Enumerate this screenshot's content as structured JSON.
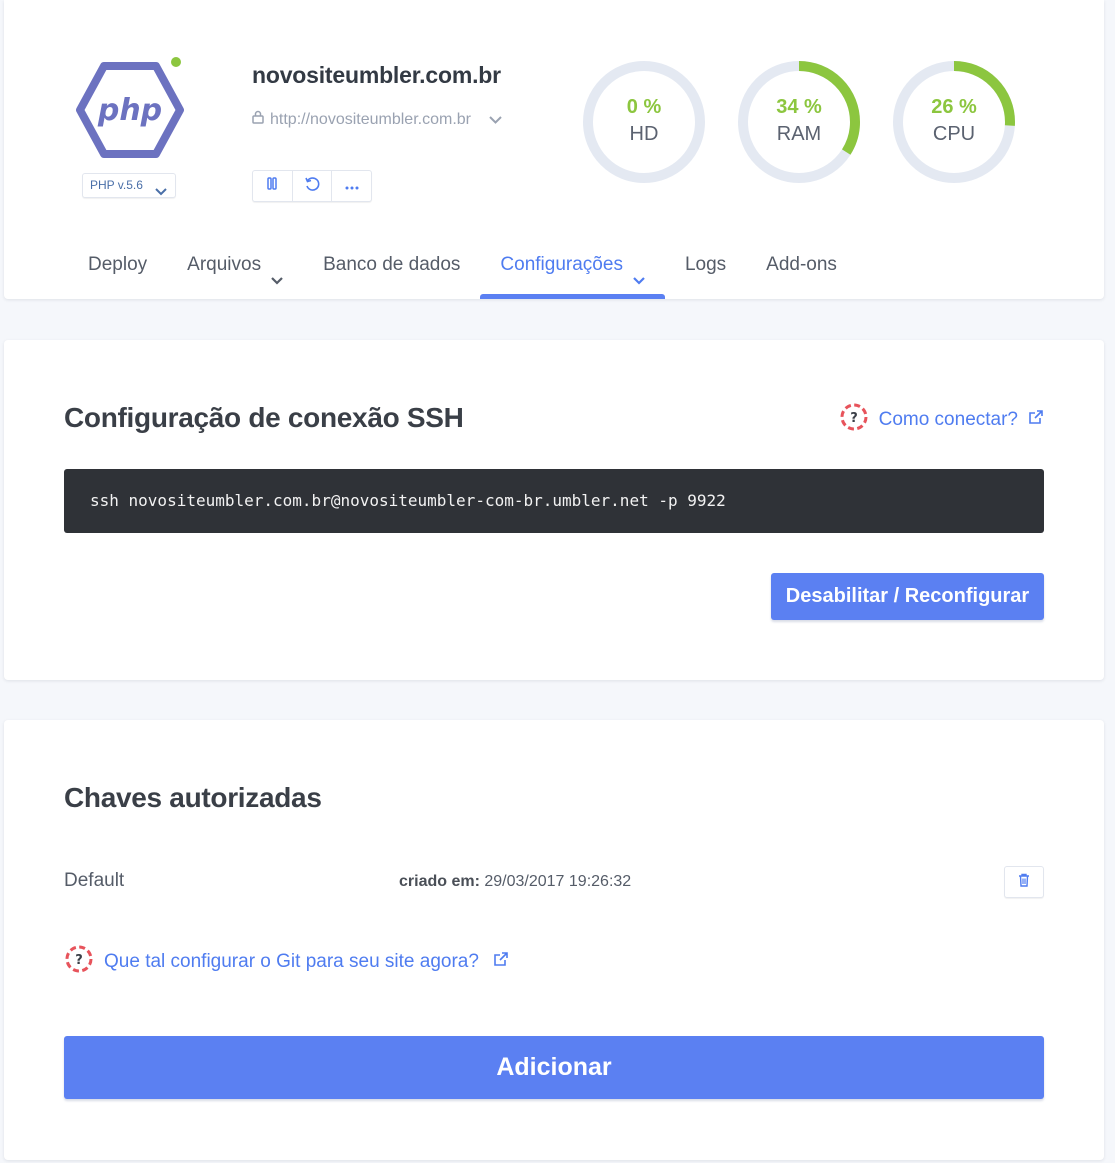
{
  "colors": {
    "accent": "#5b80f2",
    "link": "#4f7cf0",
    "gauge_fill": "#8cc63f",
    "gauge_track": "#e4e9f2",
    "php_logo": "#6c72c0",
    "online": "#8cc63f",
    "code_bg": "#2f3237"
  },
  "header": {
    "site_name": "novositeumbler.com.br",
    "site_url": "http://novositeumbler.com.br",
    "php_version": "PHP v.5.6",
    "logo_text": "php",
    "icons": {
      "logo": "php-logo-icon",
      "lock": "lock-icon",
      "pause": "pause-icon",
      "restart": "restart-icon",
      "more": "more-icon"
    }
  },
  "gauges": [
    {
      "label": "HD",
      "value": 0,
      "display": "0 %"
    },
    {
      "label": "RAM",
      "value": 34,
      "display": "34 %"
    },
    {
      "label": "CPU",
      "value": 26,
      "display": "26 %"
    }
  ],
  "tabs": [
    {
      "label": "Deploy",
      "has_dropdown": false,
      "active": false
    },
    {
      "label": "Arquivos",
      "has_dropdown": true,
      "active": false
    },
    {
      "label": "Banco de dados",
      "has_dropdown": false,
      "active": false
    },
    {
      "label": "Configurações",
      "has_dropdown": true,
      "active": true
    },
    {
      "label": "Logs",
      "has_dropdown": false,
      "active": false
    },
    {
      "label": "Add-ons",
      "has_dropdown": false,
      "active": false
    }
  ],
  "ssh": {
    "title": "Configuração de conexão SSH",
    "help_link": "Como conectar?",
    "command": "ssh novositeumbler.com.br@novositeumbler-com-br.umbler.net -p 9922",
    "reconfig_button": "Desabilitar / Reconfigurar"
  },
  "keys": {
    "title": "Chaves autorizadas",
    "items": [
      {
        "name": "Default",
        "created_label": "criado em:",
        "created_value": "29/03/2017 19:26:32"
      }
    ],
    "git_link": "Que tal configurar o Git para seu site agora?",
    "add_button": "Adicionar"
  }
}
